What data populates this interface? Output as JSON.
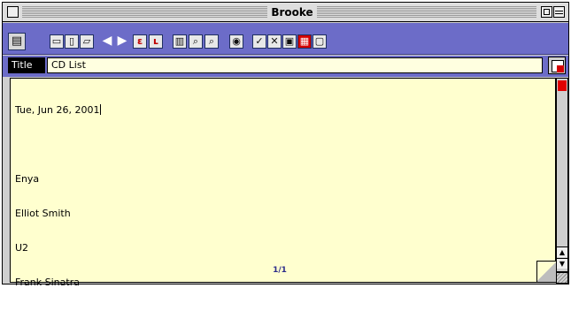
{
  "window": {
    "title": "Brooke"
  },
  "toolbar": {
    "icons": [
      {
        "name": "calculator-icon",
        "glyph": "▤"
      },
      {
        "name": "folder-icon",
        "glyph": "▭"
      },
      {
        "name": "new-document-icon",
        "glyph": "▯"
      },
      {
        "name": "open-document-icon",
        "glyph": "▱"
      },
      {
        "name": "previous-arrow-icon",
        "glyph": "◀"
      },
      {
        "name": "next-arrow-icon",
        "glyph": "▶"
      },
      {
        "name": "first-record-icon",
        "glyph": "ε"
      },
      {
        "name": "last-record-icon",
        "glyph": "ʟ"
      },
      {
        "name": "trash-icon",
        "glyph": "▥"
      },
      {
        "name": "find-icon",
        "glyph": "⌕"
      },
      {
        "name": "find-next-icon",
        "glyph": "⌕"
      },
      {
        "name": "url-icon",
        "glyph": "◉"
      },
      {
        "name": "check-edit-icon",
        "glyph": "✓"
      },
      {
        "name": "cut-icon",
        "glyph": "✕"
      },
      {
        "name": "copy-icon",
        "glyph": "▣"
      },
      {
        "name": "paste-icon",
        "glyph": "▦"
      },
      {
        "name": "clear-icon",
        "glyph": "▢"
      }
    ]
  },
  "record": {
    "title_label": "Title",
    "title_value": "CD List",
    "date": "Tue, Jun 26, 2001",
    "artists": [
      "Enya",
      "Elliot Smith",
      "U2",
      "Frank Sinatra"
    ]
  },
  "footer": {
    "page": "1/1"
  },
  "scrollbar": {
    "up_glyph": "▲",
    "down_glyph": "▼"
  },
  "colors": {
    "toolbar": "#6c6cc8",
    "body_background": "#ffffcf",
    "accent_red": "#d40000"
  }
}
